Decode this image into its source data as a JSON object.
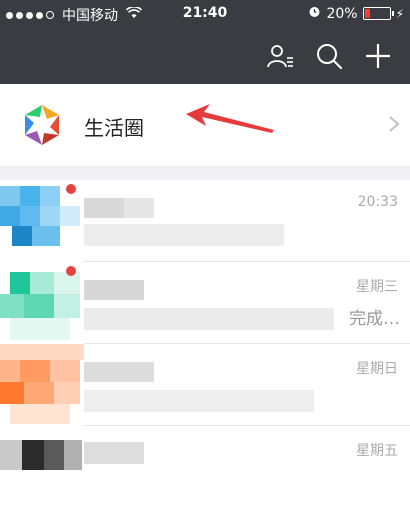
{
  "status_bar": {
    "carrier": "中国移动",
    "time": "21:40",
    "battery_percent": "20%",
    "battery_level": 0.2,
    "signal_icon": "signal-dots-icon",
    "wifi_icon": "wifi-icon",
    "alarm_icon": "alarm-icon"
  },
  "nav": {
    "icons": [
      "contacts-icon",
      "search-icon",
      "plus-icon"
    ],
    "background": "#3a3c41"
  },
  "moments": {
    "label": "生活圈",
    "icon": "moments-aperture-icon",
    "annotation": "red-arrow-icon",
    "arrow_color": "#e63b3b"
  },
  "chats": [
    {
      "time": "20:33",
      "preview": ""
    },
    {
      "time": "星期三",
      "preview": "完成…"
    },
    {
      "time": "星期日",
      "preview": ""
    },
    {
      "time": "星期五",
      "preview": ""
    }
  ]
}
